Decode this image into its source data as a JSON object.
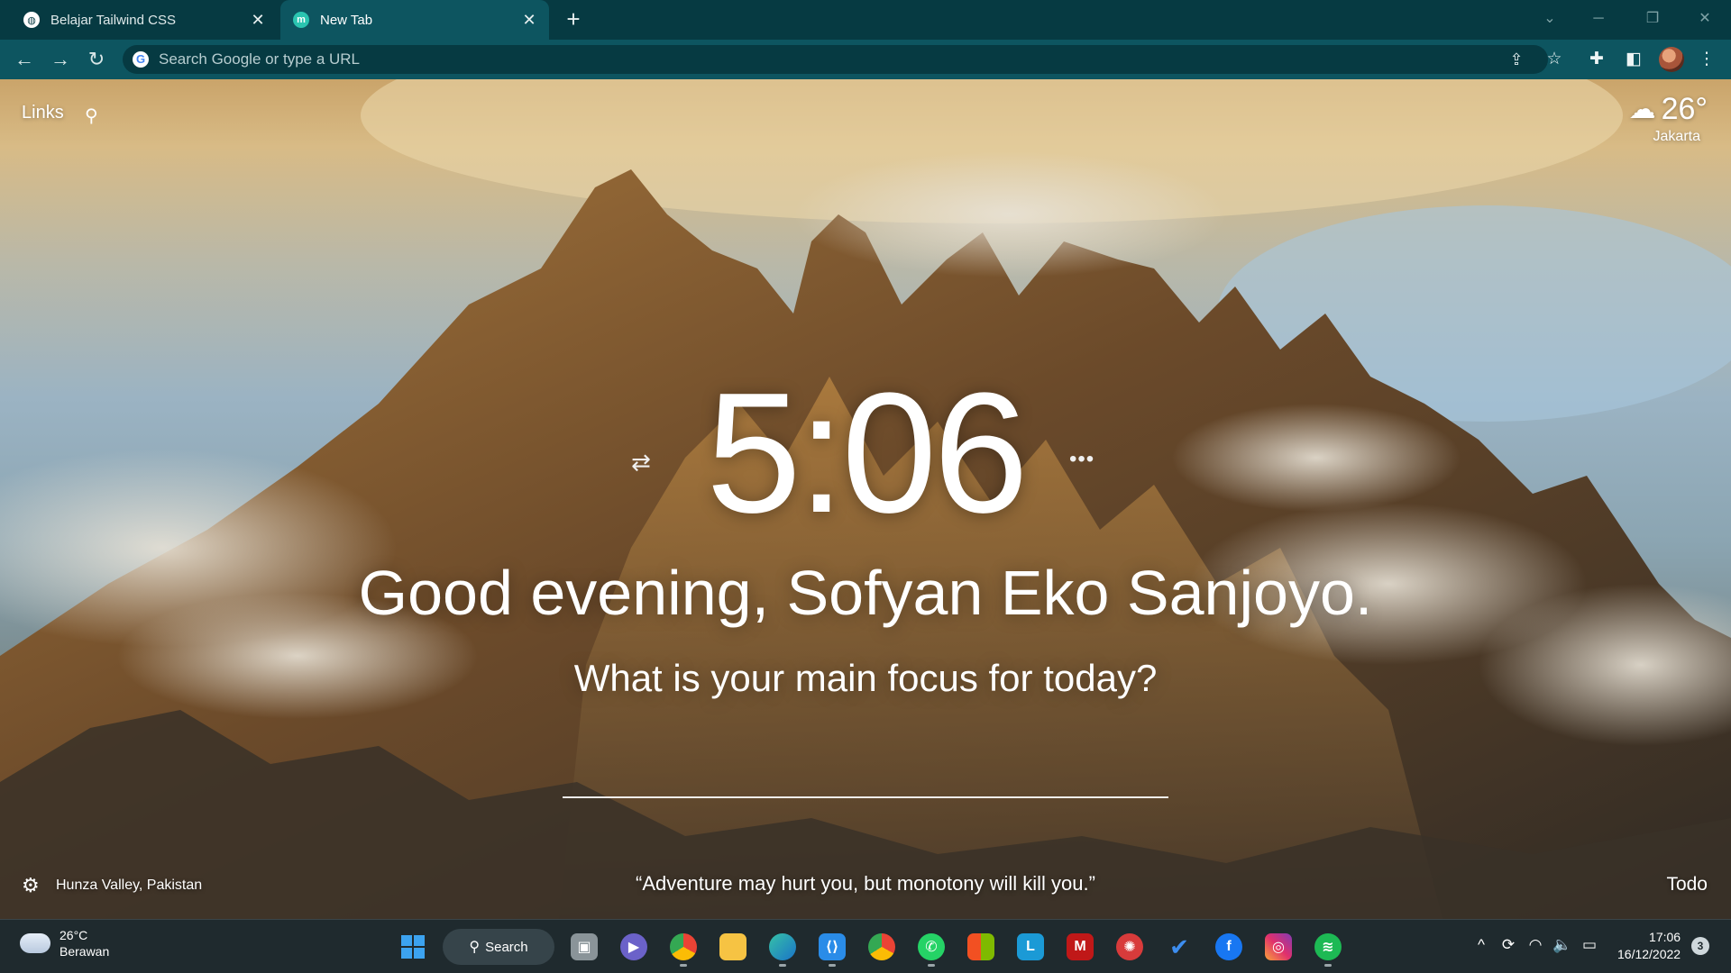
{
  "tabs": [
    {
      "title": "Belajar Tailwind CSS",
      "favicon": "globe-icon"
    },
    {
      "title": "New Tab",
      "favicon": "momentum-icon",
      "favicon_letter": "m",
      "active": true
    }
  ],
  "omnibox": {
    "placeholder": "Search Google or type a URL",
    "value": ""
  },
  "momentum": {
    "links_label": "Links",
    "weather": {
      "temp": "26°",
      "city": "Jakarta"
    },
    "time": "5:06",
    "greeting": "Good evening, Sofyan Eko Sanjoyo.",
    "focus_question": "What is your main focus for today?",
    "focus_value": "",
    "photo_location": "Hunza Valley, Pakistan",
    "quote": "“Adventure may hurt you, but monotony will kill you.”",
    "todo_label": "Todo"
  },
  "taskbar": {
    "weather": {
      "temp": "26°C",
      "condition": "Berawan"
    },
    "search_label": "Search",
    "time": "17:06",
    "date": "16/12/2022",
    "notification_count": "3"
  }
}
